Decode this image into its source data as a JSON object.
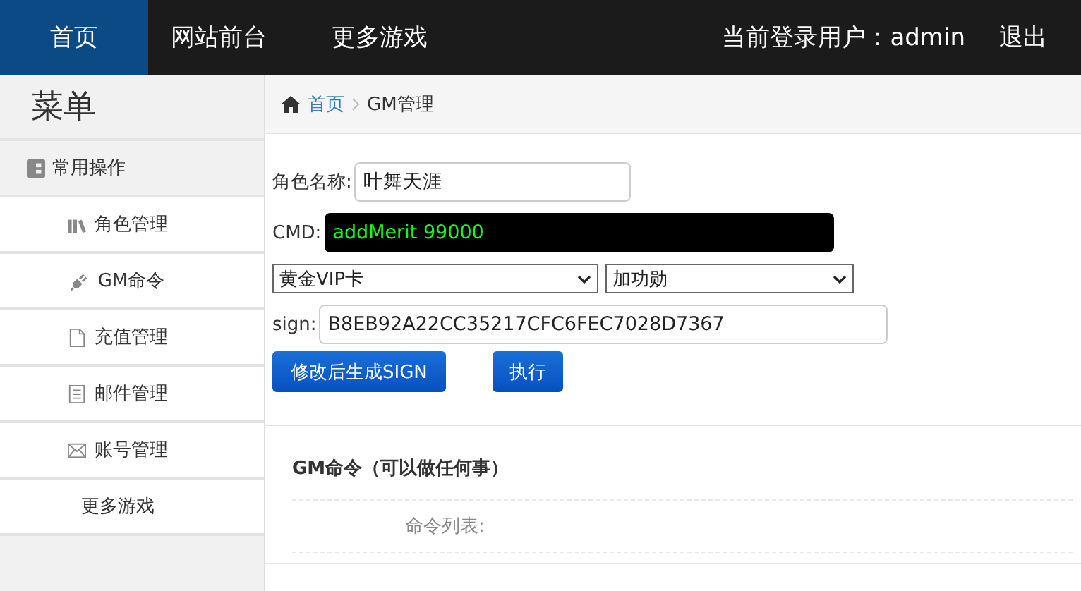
{
  "nav": {
    "tabs": [
      {
        "label": "首页",
        "selected": true
      },
      {
        "label": "网站前台",
        "selected": false
      },
      {
        "label": "更多游戏",
        "selected": false
      }
    ],
    "user_label": "当前登录用户：admin",
    "logout": "退出"
  },
  "sidebar": {
    "title": "菜单",
    "section": "常用操作",
    "items": [
      {
        "label": "角色管理",
        "selected": false
      },
      {
        "label": "GM命令",
        "selected": false
      },
      {
        "label": "充值管理",
        "selected": false
      },
      {
        "label": "邮件管理",
        "selected": false
      },
      {
        "label": "账号管理",
        "selected": false
      },
      {
        "label": "更多游戏",
        "selected": false
      }
    ]
  },
  "breadcrumb": {
    "home": "首页",
    "current": "GM管理"
  },
  "form": {
    "role_label": "角色名称:",
    "role_value": "叶舞天涯",
    "cmd_label": "CMD:",
    "cmd_value": "addMerit 99000",
    "select_1": "黄金VIP卡",
    "select_2": "加功勋",
    "sign_label": "sign:",
    "sign_value": "B8EB92A22CC35217CFC6FEC7028D7367",
    "generate_button": "修改后生成SIGN",
    "execute_button": "执行"
  },
  "panel": {
    "title": "GM命令（可以做任何事）",
    "list_label": "命令列表:"
  }
}
